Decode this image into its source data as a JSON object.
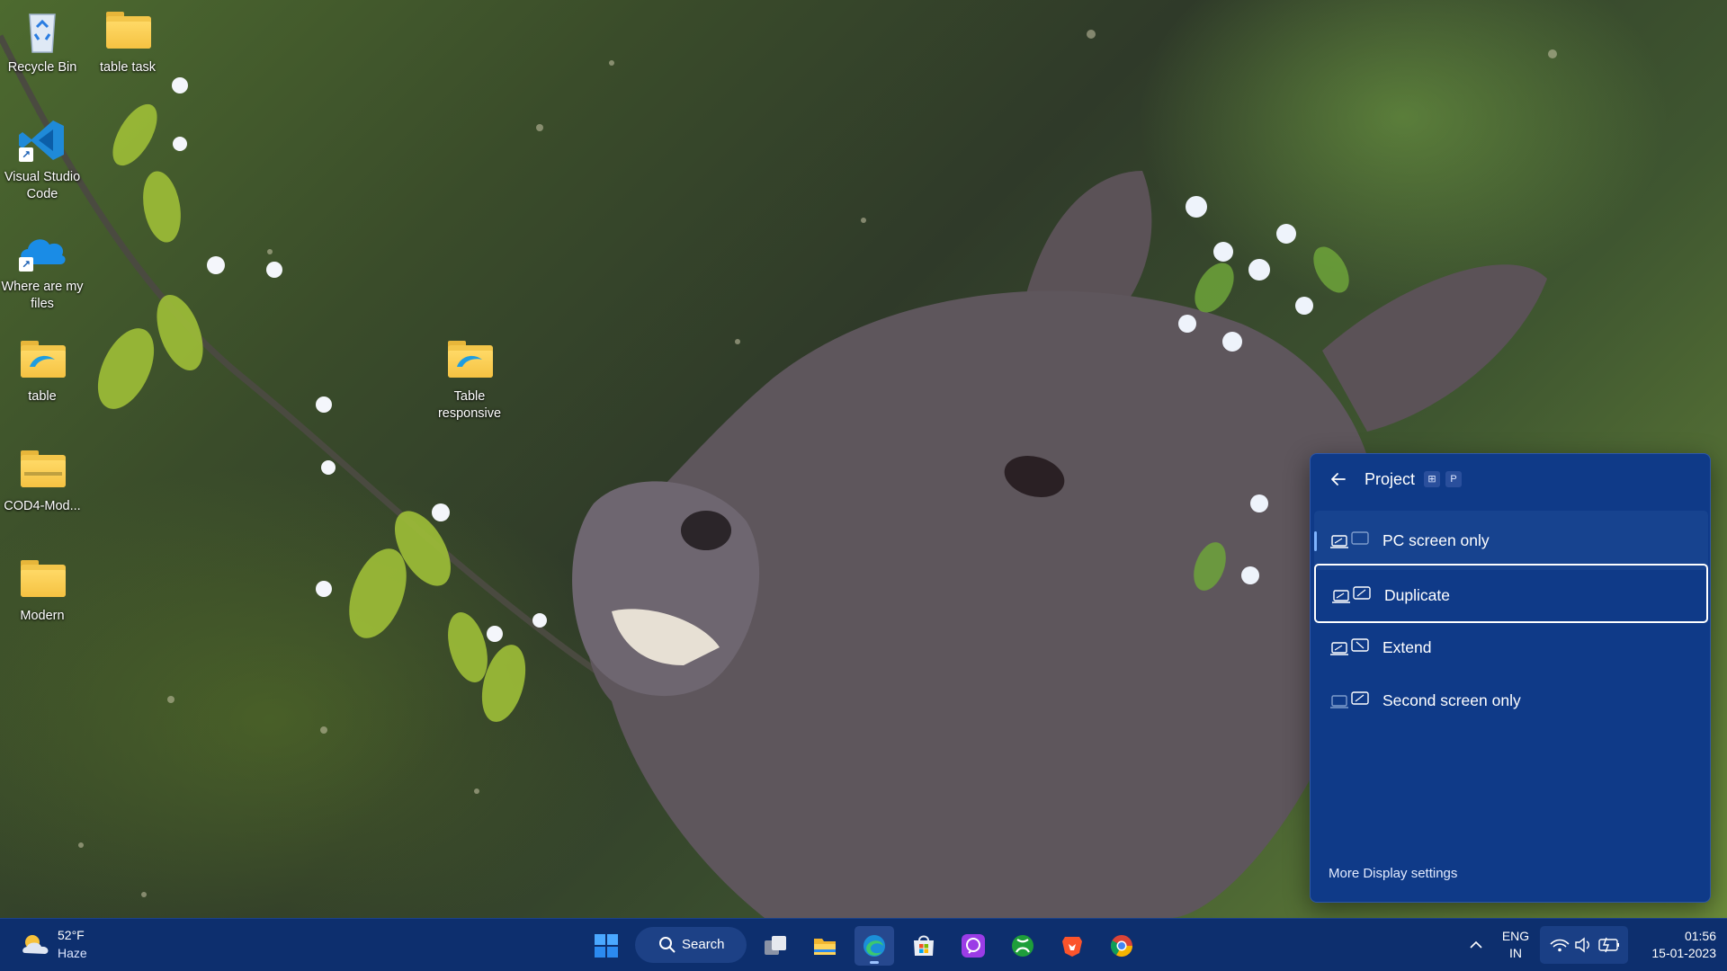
{
  "desktop": {
    "icons": [
      {
        "label": "Recycle Bin"
      },
      {
        "label": "table task"
      },
      {
        "label": "Visual Studio Code"
      },
      {
        "label": "Where are my files"
      },
      {
        "label": "table"
      },
      {
        "label": "Table responsive"
      },
      {
        "label": "COD4-Mod..."
      },
      {
        "label": "Modern"
      }
    ]
  },
  "project_panel": {
    "title": "Project",
    "shortcut_keys": [
      "⊞",
      "P"
    ],
    "options": [
      {
        "label": "PC screen only",
        "state": "selected"
      },
      {
        "label": "Duplicate",
        "state": "focused"
      },
      {
        "label": "Extend",
        "state": ""
      },
      {
        "label": "Second screen only",
        "state": ""
      }
    ],
    "more_link": "More Display settings"
  },
  "taskbar": {
    "weather": {
      "temp": "52°F",
      "condition": "Haze"
    },
    "search_label": "Search",
    "language": {
      "line1": "ENG",
      "line2": "IN"
    },
    "clock": {
      "time": "01:56",
      "date": "15-01-2023"
    },
    "pinned_apps": [
      "start-icon",
      "task-view-icon",
      "file-explorer-icon",
      "edge-icon",
      "store-icon",
      "messenger-icon",
      "xbox-icon",
      "brave-icon",
      "chrome-icon"
    ]
  },
  "colors": {
    "panel_bg": "#0f3a88",
    "taskbar_bg": "#0d2f6e",
    "accent": "#7fb4ff"
  }
}
